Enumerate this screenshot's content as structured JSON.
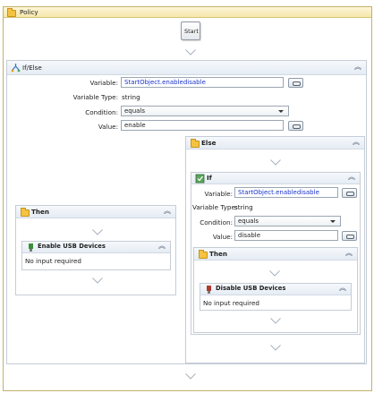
{
  "policy": {
    "title": "Policy",
    "start_label": "Start"
  },
  "outer_if": {
    "title": "If/Else",
    "variable_label": "Variable:",
    "variable_value": "StartObject.enabledisable",
    "type_label": "Variable Type:",
    "type_value": "string",
    "condition_label": "Condition:",
    "condition_value": "equals",
    "value_label": "Value:",
    "value_value": "enable"
  },
  "then_branch": {
    "title": "Then",
    "activity": {
      "title": "Enable USB Devices",
      "body": "No input required"
    }
  },
  "else_branch": {
    "title": "Else",
    "inner_if": {
      "title": "If",
      "variable_label": "Variable:",
      "variable_value": "StartObject.enabledisable",
      "type_label": "Variable Type:",
      "type_value": "string",
      "condition_label": "Condition:",
      "condition_value": "equals",
      "value_label": "Value:",
      "value_value": "disable"
    },
    "then": {
      "title": "Then",
      "activity": {
        "title": "Disable USB Devices",
        "body": "No input required"
      }
    }
  },
  "icons": {
    "policy": "folder-icon",
    "ifelse": "branch-icon",
    "then": "folder-icon",
    "else": "folder-icon",
    "if": "condition-icon",
    "enable_usb": "usb-icon",
    "disable_usb": "usb-icon",
    "connector": "down-arrow-icon",
    "collapse": "double-chevron-up-icon"
  }
}
